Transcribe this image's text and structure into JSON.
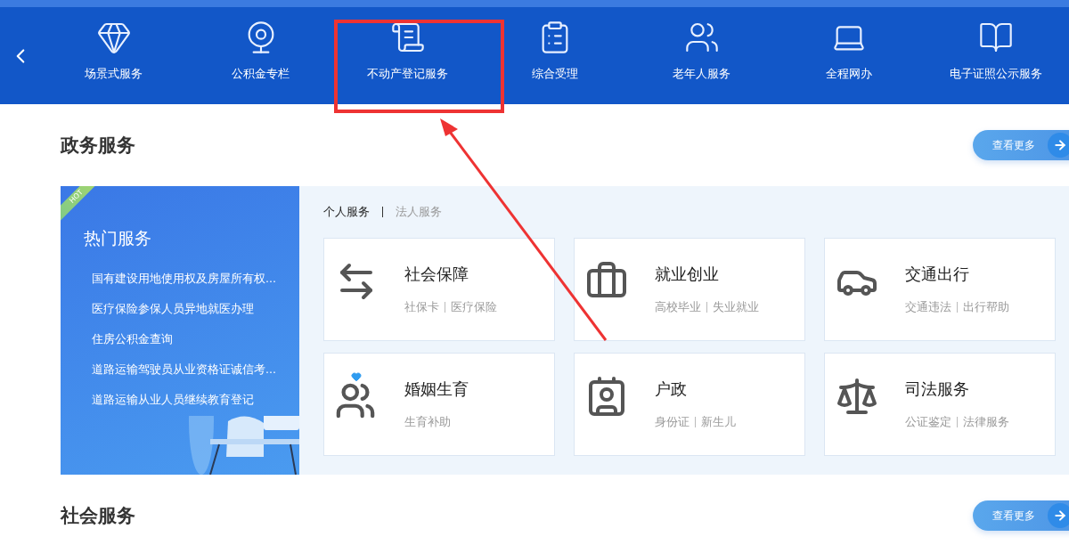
{
  "nav": {
    "items": [
      {
        "label": "场景式服务",
        "highlighted": false
      },
      {
        "label": "公积金专栏",
        "highlighted": false
      },
      {
        "label": "不动产登记服务",
        "highlighted": true
      },
      {
        "label": "综合受理",
        "highlighted": false
      },
      {
        "label": "老年人服务",
        "highlighted": false
      },
      {
        "label": "全程网办",
        "highlighted": false
      },
      {
        "label": "电子证照公示服务",
        "highlighted": false
      }
    ]
  },
  "sections": [
    {
      "title": "政务服务",
      "more": "查看更多",
      "hot": {
        "badge": "HOT",
        "title": "热门服务",
        "links": [
          "国有建设用地使用权及房屋所有权...",
          "医疗保险参保人员异地就医办理",
          "住房公积金查询",
          "道路运输驾驶员从业资格证诚信考...",
          "道路运输从业人员继续教育登记"
        ]
      },
      "tabs": [
        {
          "label": "个人服务",
          "selected": true
        },
        {
          "label": "法人服务",
          "selected": false
        }
      ],
      "cards": [
        {
          "title": "社会保障",
          "links": [
            "社保卡",
            "医疗保险"
          ]
        },
        {
          "title": "就业创业",
          "links": [
            "高校毕业",
            "失业就业"
          ]
        },
        {
          "title": "交通出行",
          "links": [
            "交通违法",
            "出行帮助"
          ]
        },
        {
          "title": "婚姻生育",
          "links": [
            "生育补助"
          ]
        },
        {
          "title": "户政",
          "links": [
            "身份证",
            "新生儿"
          ]
        },
        {
          "title": "司法服务",
          "links": [
            "公证鉴定",
            "法律服务"
          ]
        }
      ]
    },
    {
      "title": "社会服务",
      "more": "查看更多"
    }
  ]
}
